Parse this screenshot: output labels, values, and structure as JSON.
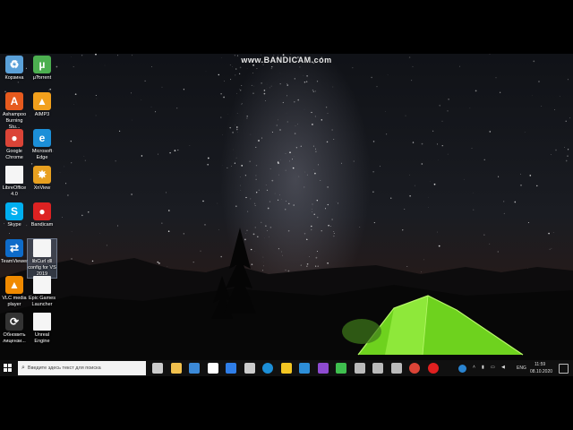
{
  "watermark": "www.BANDICAM.com",
  "desktop_icons": [
    {
      "name": "recycle-bin",
      "label": "Корзина",
      "color": "#5aa0d8",
      "glyph": "♻"
    },
    {
      "name": "utorrent",
      "label": "µTorrent",
      "color": "#4caf50",
      "glyph": "µ"
    },
    {
      "name": "ashampoo",
      "label": "Ashampoo Burning Stu...",
      "color": "#e65a1e",
      "glyph": "A"
    },
    {
      "name": "aimp3",
      "label": "AIMP3",
      "color": "#f2a01c",
      "glyph": "▲"
    },
    {
      "name": "google-chrome",
      "label": "Google Chrome",
      "color": "#db4437",
      "glyph": "●"
    },
    {
      "name": "microsoft-edge",
      "label": "Microsoft Edge",
      "color": "#1c8fd8",
      "glyph": "e"
    },
    {
      "name": "libreoffice",
      "label": "LibreOffice 4.0",
      "color": "#f5f5f5",
      "glyph": ""
    },
    {
      "name": "xnview",
      "label": "XnView",
      "color": "#e8a020",
      "glyph": "✸"
    },
    {
      "name": "skype",
      "label": "Skype",
      "color": "#00aff0",
      "glyph": "S"
    },
    {
      "name": "bandicam",
      "label": "Bandicam",
      "color": "#d22",
      "glyph": "●"
    },
    {
      "name": "teamviewer",
      "label": "TeamViewer",
      "color": "#0e6bc9",
      "glyph": "⇄"
    },
    {
      "name": "libcurl-config",
      "label": "libCurl dll config for VS 2019",
      "color": "#f5f5f5",
      "glyph": ""
    },
    {
      "name": "vlc",
      "label": "VLC media player",
      "color": "#f08a00",
      "glyph": "▲"
    },
    {
      "name": "epic-games",
      "label": "Epic Games Launcher",
      "color": "#f5f5f5",
      "glyph": ""
    },
    {
      "name": "update-licenses",
      "label": "Обновить лицензи...",
      "color": "#333",
      "glyph": "⟳"
    },
    {
      "name": "unreal-engine",
      "label": "Unreal Engine",
      "color": "#f5f5f5",
      "glyph": ""
    }
  ],
  "taskbar": {
    "search_placeholder": "Введите здесь текст для поиска",
    "language": "ENG",
    "time": "11:59",
    "date": "08.10.2020",
    "apps": [
      {
        "name": "task-view-icon",
        "color": "#cccccc"
      },
      {
        "name": "file-explorer-icon",
        "color": "#f2c14e"
      },
      {
        "name": "mail-icon",
        "color": "#3c8ad8"
      },
      {
        "name": "amazon-icon",
        "color": "#ffffff"
      },
      {
        "name": "dropbox-icon",
        "color": "#2f7ee8"
      },
      {
        "name": "sticky-app-icon",
        "color": "#cccccc"
      },
      {
        "name": "edge-icon",
        "color": "#1c8fd8"
      },
      {
        "name": "notes-icon",
        "color": "#f3c623"
      },
      {
        "name": "vscode-icon",
        "color": "#2d8ed8"
      },
      {
        "name": "visual-studio-icon",
        "color": "#8e4bd0"
      },
      {
        "name": "chat-icon",
        "color": "#3fbf4f"
      },
      {
        "name": "terminal-icon",
        "color": "#bbbbbb"
      },
      {
        "name": "monitor-icon",
        "color": "#bbbbbb"
      },
      {
        "name": "window-icon",
        "color": "#bbbbbb"
      },
      {
        "name": "chrome-icon",
        "color": "#db4437"
      },
      {
        "name": "record-icon",
        "color": "#e02020"
      }
    ]
  }
}
